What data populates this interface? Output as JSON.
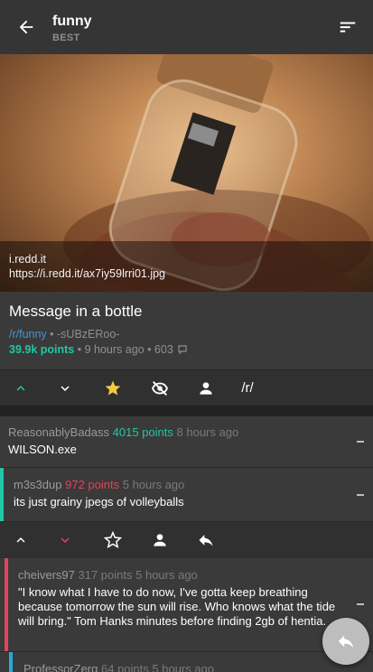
{
  "header": {
    "title": "funny",
    "subtitle": "BEST"
  },
  "hero": {
    "domain": "i.redd.it",
    "url": "https://i.redd.it/ax7iy59lrri01.jpg"
  },
  "post": {
    "title": "Message in a bottle",
    "subreddit": "/r/funny",
    "author_sep": " • ",
    "author": "-sUBzERoo-",
    "points": "39.9k points",
    "time": " • 9 hours ago • ",
    "comments": "603"
  },
  "post_actions": {
    "subreddit_link": "/r/"
  },
  "comments": [
    {
      "author": "ReasonablyBadass",
      "points": "4015 points",
      "time": "8 hours ago",
      "body": "WILSON.exe"
    },
    {
      "author": "m3s3dup",
      "points": "972 points",
      "time": "5 hours ago",
      "body": "its just grainy jpegs of volleyballs"
    },
    {
      "author": "cheivers97",
      "points": "317 points",
      "time": "5 hours ago",
      "body": "\"I know what I have to do now, I've gotta keep breathing because tomorrow the sun will rise. Who knows what the tide will bring.\" Tom Hanks minutes before finding 2gb of hentia."
    },
    {
      "author": "ProfessorZerg",
      "points": "64 points",
      "time": "5 hours ago",
      "body": ""
    }
  ],
  "colors": {
    "accent_green": "#1ec8a5",
    "downvote_red": "#e0435d",
    "star_yellow": "#f5c842",
    "link_blue": "#4a90d9"
  }
}
